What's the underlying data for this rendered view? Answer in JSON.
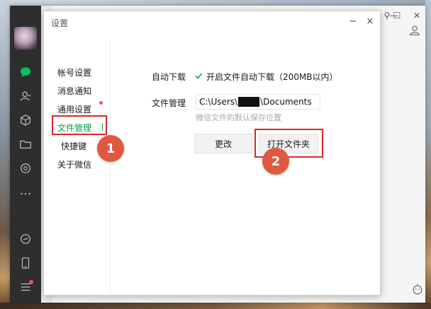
{
  "dialog": {
    "title": "设置",
    "minimize": "−",
    "close": "×"
  },
  "nav": {
    "items": [
      {
        "label": "帐号设置"
      },
      {
        "label": "消息通知"
      },
      {
        "label": "通用设置"
      },
      {
        "label": "文件管理"
      },
      {
        "label": "快捷键"
      },
      {
        "label": "关于微信"
      }
    ],
    "active_index": 3
  },
  "file_settings": {
    "auto_download_label": "自动下载",
    "auto_download_option": "开启文件自动下载（200MB以内）",
    "auto_download_checked": true,
    "file_manage_label": "文件管理",
    "path_prefix": "C:\\Users\\",
    "path_suffix": "\\Documents",
    "path_hint": "微信文件的默认保存位置",
    "change_button": "更改",
    "open_folder_button": "打开文件夹"
  },
  "annotations": {
    "step1": "1",
    "step2": "2"
  },
  "window": {
    "pin": "⚲",
    "minimize": "—",
    "maximize": "☐",
    "close": "✕"
  },
  "colors": {
    "accent_green": "#07a33c",
    "highlight_red": "#d9272e",
    "badge_orange": "#e0583f",
    "sidebar_dark": "#2e2e2e"
  },
  "icons": {
    "sidebar": [
      "chat-icon",
      "contacts-icon",
      "favorites-icon",
      "folder-icon",
      "moments-icon",
      "more-icon",
      "miniprogram-icon",
      "phone-icon",
      "menu-icon"
    ],
    "top_right": "add-user-icon",
    "bottom_right": "robot-icon"
  }
}
